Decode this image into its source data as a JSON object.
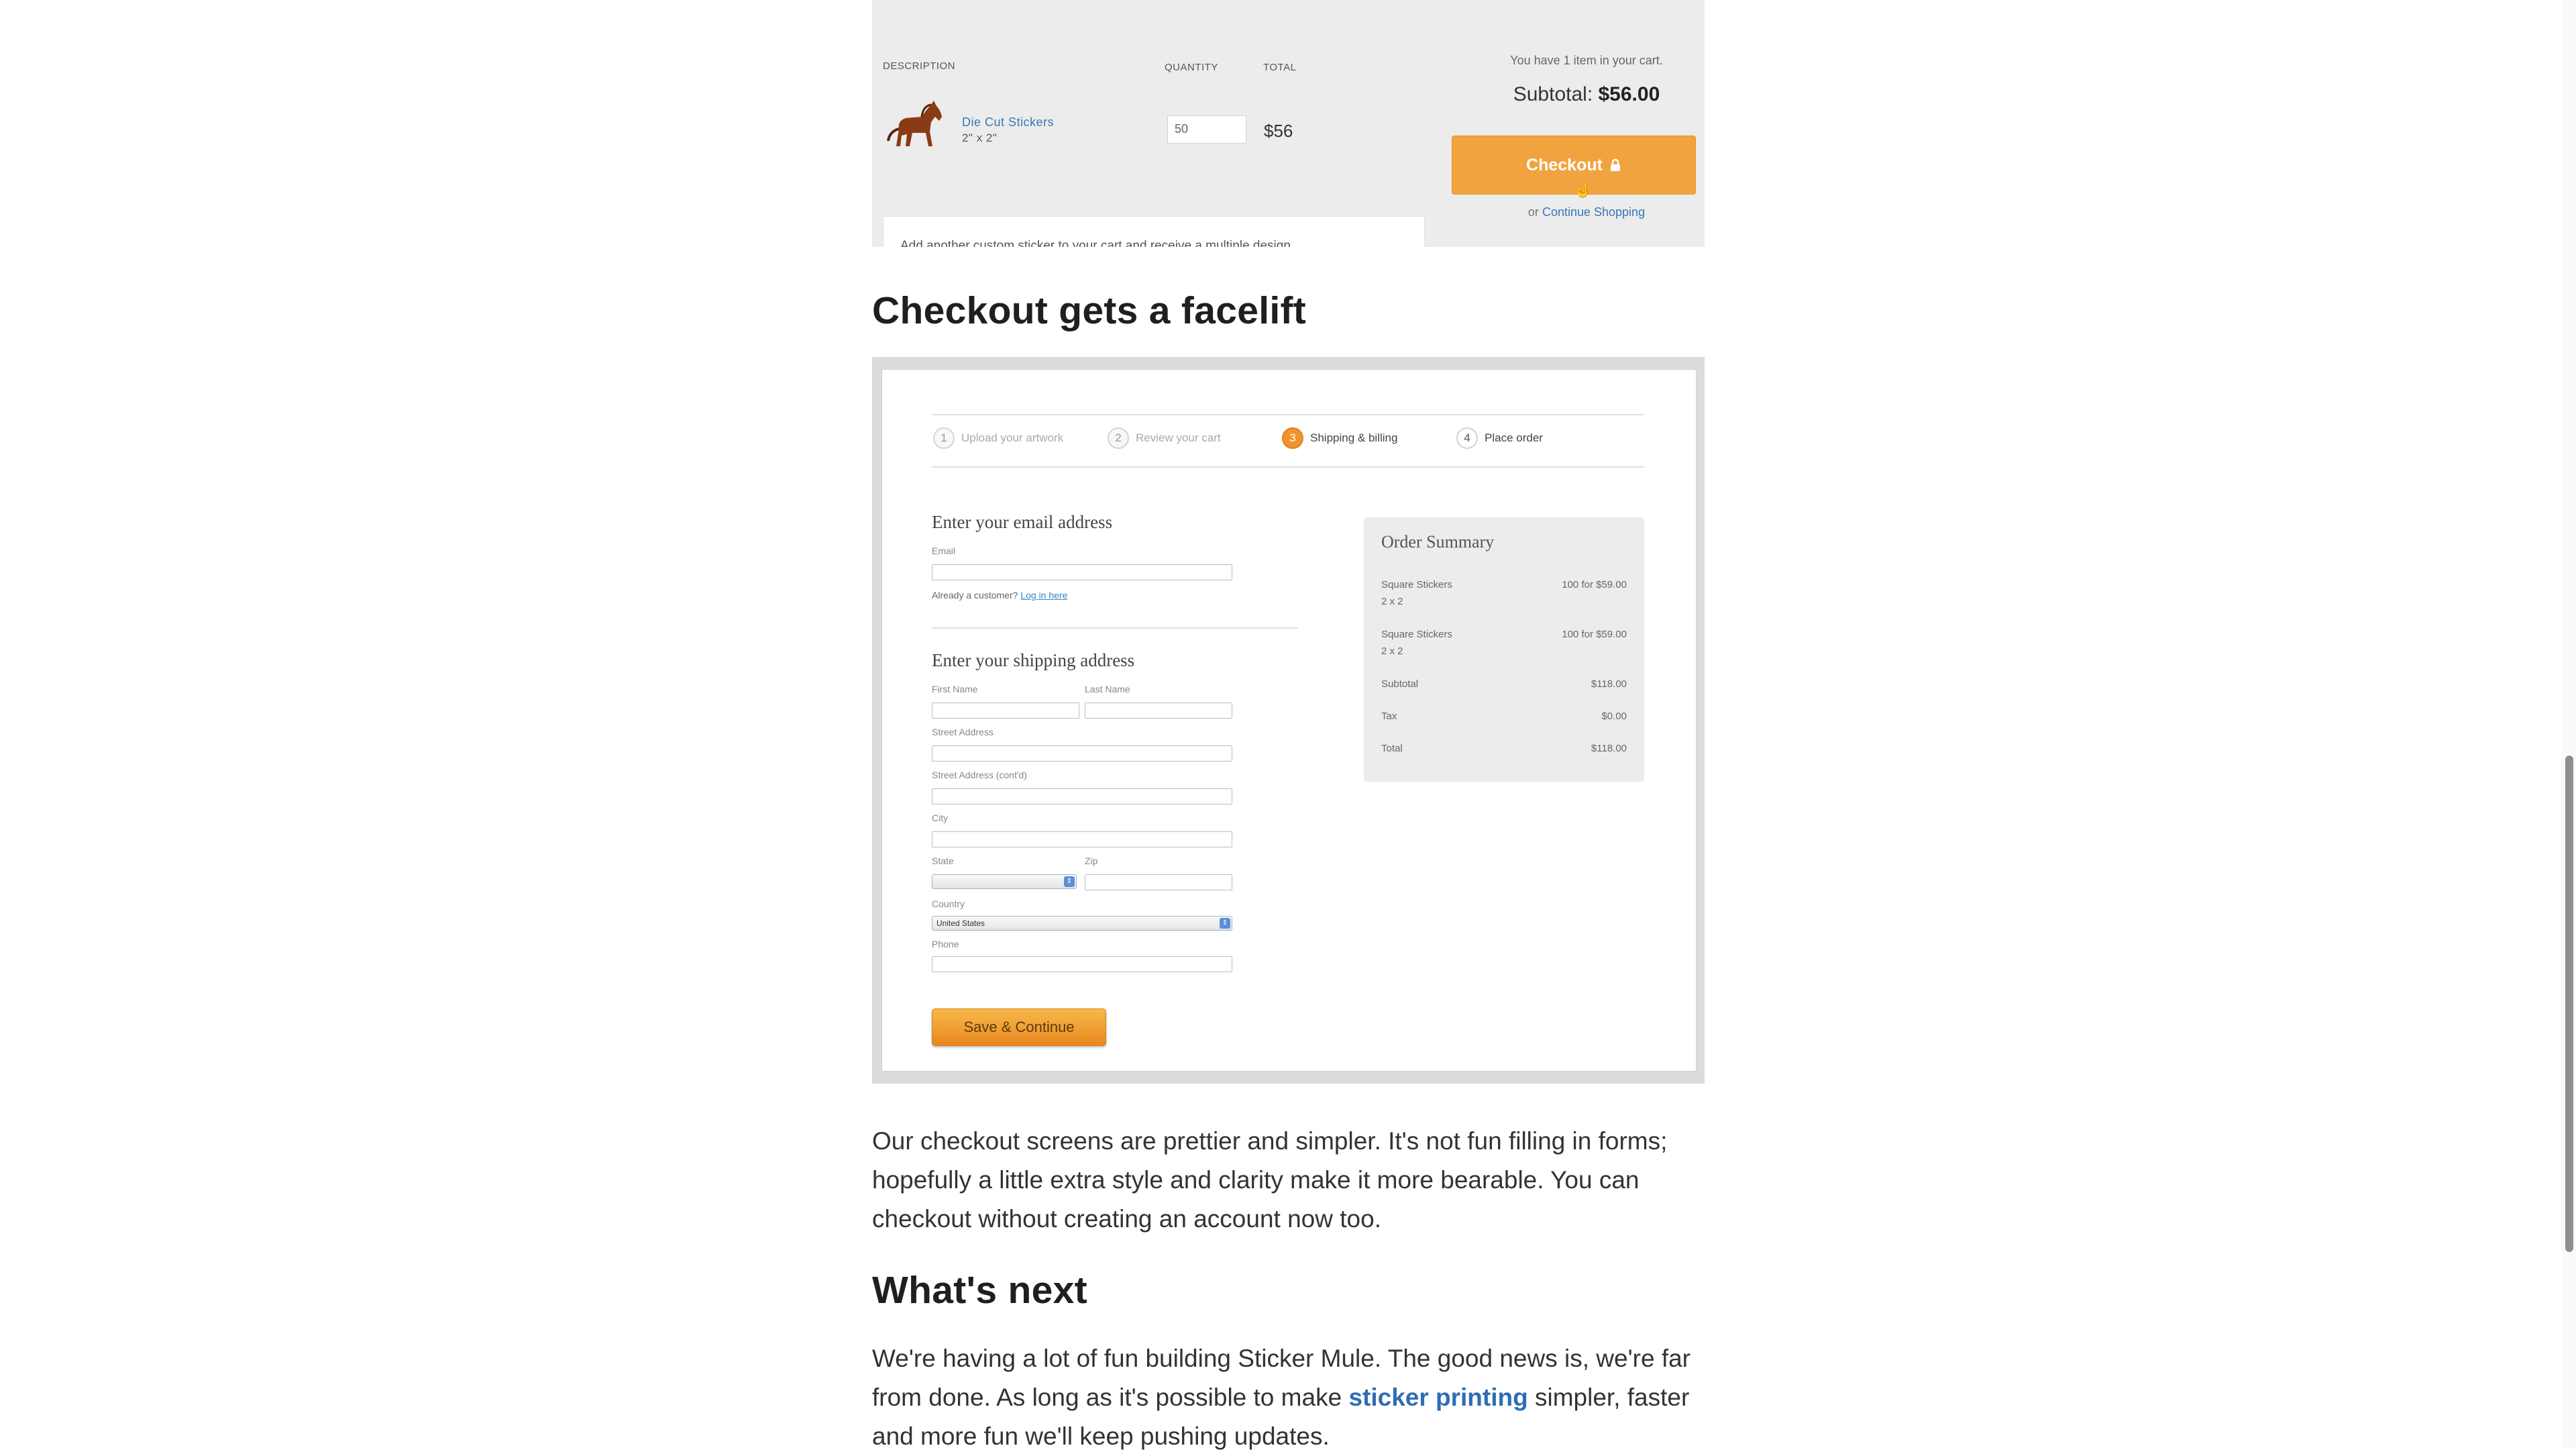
{
  "cart_shot": {
    "col_description": "DESCRIPTION",
    "col_quantity": "QUANTITY",
    "col_total": "TOTAL",
    "item_name": "Die Cut Stickers",
    "item_size": "2\" x 2\"",
    "item_qty": "50",
    "item_total": "$56",
    "cart_count": "You have 1 item in your cart.",
    "subtotal_label": "Subtotal:",
    "subtotal_value": "$56.00",
    "checkout_label": "Checkout",
    "continue_prefix": "or",
    "continue_link": "Continue Shopping",
    "promo_text": "Add another custom sticker to your cart and receive a multiple design"
  },
  "heading_checkout": "Checkout gets a facelift",
  "checkout_shot": {
    "steps": [
      {
        "num": "1",
        "label": "Upload your artwork"
      },
      {
        "num": "2",
        "label": "Review your cart"
      },
      {
        "num": "3",
        "label": "Shipping & billing"
      },
      {
        "num": "4",
        "label": "Place order"
      }
    ],
    "email_heading": "Enter your email address",
    "email_label": "Email",
    "customer_prompt": "Already a customer?",
    "login_link": "Log in here",
    "shipping_heading": "Enter your shipping address",
    "first_name_label": "First Name",
    "last_name_label": "Last Name",
    "street_label": "Street Address",
    "street2_label": "Street Address (cont'd)",
    "city_label": "City",
    "state_label": "State",
    "zip_label": "Zip",
    "country_label": "Country",
    "country_value": "United States",
    "phone_label": "Phone",
    "save_button": "Save & Continue",
    "summary": {
      "title": "Order Summary",
      "items": [
        {
          "name": "Square Stickers",
          "size": "2 x 2",
          "price": "100 for $59.00"
        },
        {
          "name": "Square Stickers",
          "size": "2 x 2",
          "price": "100 for $59.00"
        }
      ],
      "subtotal_label": "Subtotal",
      "subtotal_value": "$118.00",
      "tax_label": "Tax",
      "tax_value": "$0.00",
      "total_label": "Total",
      "total_value": "$118.00"
    }
  },
  "para_checkout": "Our checkout screens are prettier and simpler. It's not fun filling in forms; hopefully a little extra style and clarity make it more bearable. You can checkout without creating an account now too.",
  "heading_next": "What's next",
  "para_next": {
    "before": "We're having a lot of fun building Sticker Mule. The good news is, we're far from done. As long as it's possible to make ",
    "link": "sticker printing",
    "after": " simpler, faster and more fun we'll keep pushing updates."
  }
}
